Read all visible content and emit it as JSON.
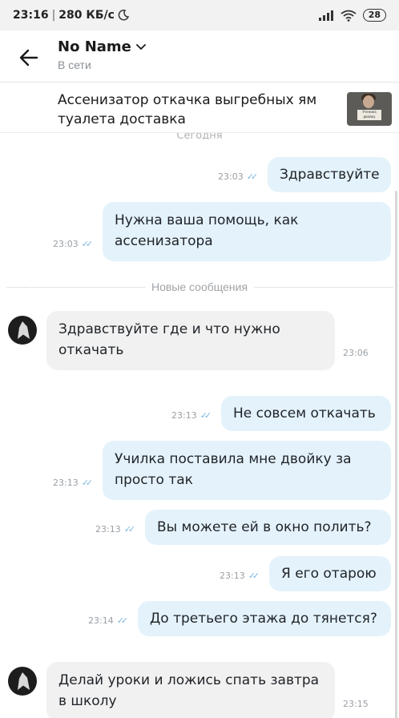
{
  "status_bar": {
    "time": "23:16",
    "net_speed": "280 КБ/с",
    "moon_icon": "moon-icon",
    "signal_icon": "signal-icon",
    "wifi_icon": "wifi-icon",
    "battery": "28"
  },
  "header": {
    "title": "No Name",
    "subtitle": "В сети"
  },
  "listing": {
    "title": "Ассенизатор откачка выгребных ям туалета доставка",
    "thumb_sign_text": "Ученика двойку"
  },
  "chat": {
    "date_label": "Сегодня",
    "new_messages_label": "Новые сообщения",
    "messages": [
      {
        "dir": "out",
        "text": "Здравствуйте",
        "time": "23:03"
      },
      {
        "dir": "out",
        "text": "Нужна ваша помощь, как ассенизатора",
        "time": "23:03"
      },
      {
        "dir": "in",
        "text": "Здравствуйте где и что нужно откачать",
        "time": "23:06"
      },
      {
        "dir": "out",
        "text": "Не совсем откачать",
        "time": "23:13"
      },
      {
        "dir": "out",
        "text": "Училка поставила мне двойку за просто так",
        "time": "23:13"
      },
      {
        "dir": "out",
        "text": "Вы можете ей в окно полить?",
        "time": "23:13"
      },
      {
        "dir": "out",
        "text": "Я его отарою",
        "time": "23:13"
      },
      {
        "dir": "out",
        "text": "До третьего этажа до тянется?",
        "time": "23:14"
      },
      {
        "dir": "in",
        "text": "Делай уроки и ложись спать завтра в школу",
        "time": "23:15"
      }
    ]
  },
  "colors": {
    "outgoing_bubble": "#e4f2fb",
    "incoming_bubble": "#f1f1f1",
    "read_check": "#7bb7e0"
  }
}
